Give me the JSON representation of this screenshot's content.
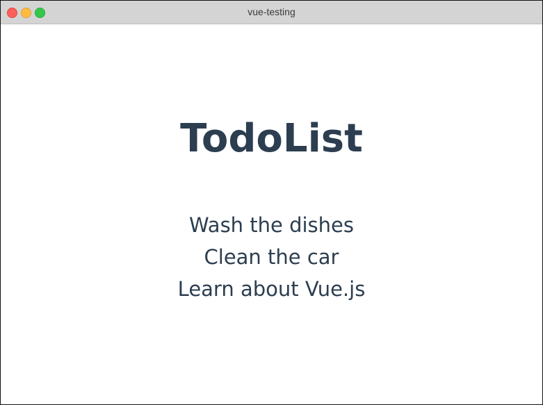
{
  "window": {
    "title": "vue-testing",
    "controls": [
      {
        "name": "close",
        "color": "#fc605b"
      },
      {
        "name": "minimize",
        "color": "#fdbc40"
      },
      {
        "name": "maximize",
        "color": "#34c84a"
      }
    ]
  },
  "app": {
    "heading": "TodoList",
    "text_color": "#2c3e50",
    "todos": [
      {
        "label": "Wash the dishes"
      },
      {
        "label": "Clean the car"
      },
      {
        "label": "Learn about Vue.js"
      }
    ]
  }
}
